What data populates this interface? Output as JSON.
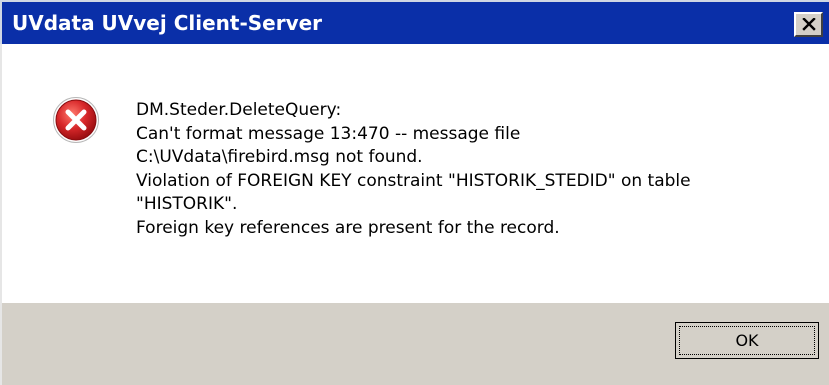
{
  "window": {
    "title": "UVdata UVvej Client-Server",
    "close_icon": "close-icon",
    "title_bar_color": "#0a2fa8",
    "footer_color": "#d4d0c8"
  },
  "message": {
    "icon": "error-icon",
    "icon_color": "#c8181e",
    "lines": [
      "DM.Steder.DeleteQuery:",
      "Can't format message 13:470 -- message file",
      "C:\\UVdata\\firebird.msg not found.",
      "Violation of FOREIGN KEY constraint \"HISTORIK_STEDID\" on table",
      "\"HISTORIK\".",
      "Foreign key references are present for the record."
    ]
  },
  "buttons": {
    "ok_label": "OK"
  }
}
